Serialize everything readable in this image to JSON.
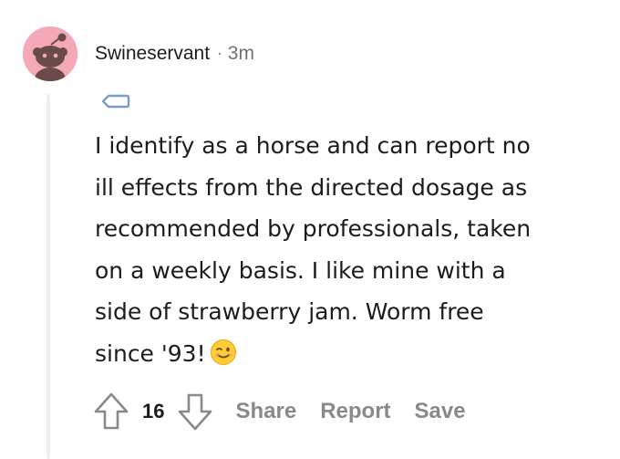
{
  "comment": {
    "username": "Swineservant",
    "separator": "·",
    "timestamp": "3m",
    "body_lines": [
      "I identify as a horse and can report no",
      "ill effects from the directed dosage as",
      "recommended by professionals, taken",
      "on a weekly basis. I like mine with a",
      "side of strawberry jam. Worm free",
      "since '93!"
    ],
    "emoji": "winking-face",
    "score": "16"
  },
  "actions": {
    "share_label": "Share",
    "report_label": "Report",
    "save_label": "Save"
  },
  "colors": {
    "avatar_bg": "#f4a8b8",
    "avatar_figure": "#6b4a4a",
    "meta_gray": "#878a8c",
    "thread_line": "#edeff1",
    "flair_blue": "#7a9cc6",
    "text": "#1c1c1c"
  },
  "icons": {
    "avatar": "snoo-avatar-icon",
    "flair": "tag-icon",
    "upvote": "upvote-arrow-icon",
    "downvote": "downvote-arrow-icon"
  }
}
